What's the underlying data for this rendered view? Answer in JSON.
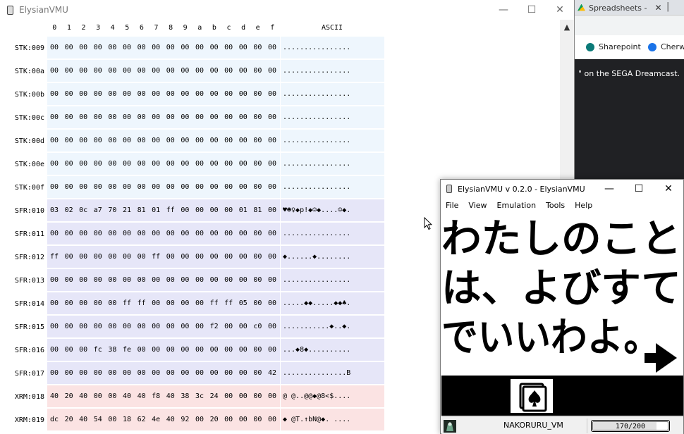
{
  "background_browser": {
    "tab_title": "Spreadsheets -",
    "tab_close": "✕",
    "bookmarks": [
      {
        "label": "Sharepoint",
        "color": "#0b7a78"
      },
      {
        "label": "Cherw",
        "color": "#1a73e8"
      }
    ],
    "headline": "\" on the SEGA Dreamcast."
  },
  "memory_window": {
    "title": "ElysianVMU",
    "minimize": "—",
    "maximize": "☐",
    "close": "✕",
    "scroll_up": "▲",
    "columns": [
      "0",
      "1",
      "2",
      "3",
      "4",
      "5",
      "6",
      "7",
      "8",
      "9",
      "a",
      "b",
      "c",
      "d",
      "e",
      "f"
    ],
    "ascii_header": "ASCII",
    "rows": [
      {
        "region": "stk",
        "label": "STK:009",
        "bytes": [
          "00",
          "00",
          "00",
          "00",
          "00",
          "00",
          "00",
          "00",
          "00",
          "00",
          "00",
          "00",
          "00",
          "00",
          "00",
          "00"
        ],
        "ascii": "................"
      },
      {
        "region": "stk",
        "label": "STK:00a",
        "bytes": [
          "00",
          "00",
          "00",
          "00",
          "00",
          "00",
          "00",
          "00",
          "00",
          "00",
          "00",
          "00",
          "00",
          "00",
          "00",
          "00"
        ],
        "ascii": "................"
      },
      {
        "region": "stk",
        "label": "STK:00b",
        "bytes": [
          "00",
          "00",
          "00",
          "00",
          "00",
          "00",
          "00",
          "00",
          "00",
          "00",
          "00",
          "00",
          "00",
          "00",
          "00",
          "00"
        ],
        "ascii": "................"
      },
      {
        "region": "stk",
        "label": "STK:00c",
        "bytes": [
          "00",
          "00",
          "00",
          "00",
          "00",
          "00",
          "00",
          "00",
          "00",
          "00",
          "00",
          "00",
          "00",
          "00",
          "00",
          "00"
        ],
        "ascii": "................"
      },
      {
        "region": "stk",
        "label": "STK:00d",
        "bytes": [
          "00",
          "00",
          "00",
          "00",
          "00",
          "00",
          "00",
          "00",
          "00",
          "00",
          "00",
          "00",
          "00",
          "00",
          "00",
          "00"
        ],
        "ascii": "................"
      },
      {
        "region": "stk",
        "label": "STK:00e",
        "bytes": [
          "00",
          "00",
          "00",
          "00",
          "00",
          "00",
          "00",
          "00",
          "00",
          "00",
          "00",
          "00",
          "00",
          "00",
          "00",
          "00"
        ],
        "ascii": "................"
      },
      {
        "region": "stk",
        "label": "STK:00f",
        "bytes": [
          "00",
          "00",
          "00",
          "00",
          "00",
          "00",
          "00",
          "00",
          "00",
          "00",
          "00",
          "00",
          "00",
          "00",
          "00",
          "00"
        ],
        "ascii": "................"
      },
      {
        "region": "sfr",
        "label": "SFR:010",
        "bytes": [
          "03",
          "02",
          "0c",
          "a7",
          "70",
          "21",
          "81",
          "01",
          "ff",
          "00",
          "00",
          "00",
          "00",
          "01",
          "81",
          "00"
        ],
        "ascii": "♥☻♀◆p!◆☺◆....☺◆."
      },
      {
        "region": "sfr",
        "label": "SFR:011",
        "bytes": [
          "00",
          "00",
          "00",
          "00",
          "00",
          "00",
          "00",
          "00",
          "00",
          "00",
          "00",
          "00",
          "00",
          "00",
          "00",
          "00"
        ],
        "ascii": "................"
      },
      {
        "region": "sfr",
        "label": "SFR:012",
        "bytes": [
          "ff",
          "00",
          "00",
          "00",
          "00",
          "00",
          "00",
          "ff",
          "00",
          "00",
          "00",
          "00",
          "00",
          "00",
          "00",
          "00"
        ],
        "ascii": "◆......◆........"
      },
      {
        "region": "sfr",
        "label": "SFR:013",
        "bytes": [
          "00",
          "00",
          "00",
          "00",
          "00",
          "00",
          "00",
          "00",
          "00",
          "00",
          "00",
          "00",
          "00",
          "00",
          "00",
          "00"
        ],
        "ascii": "................"
      },
      {
        "region": "sfr",
        "label": "SFR:014",
        "bytes": [
          "00",
          "00",
          "00",
          "00",
          "00",
          "ff",
          "ff",
          "00",
          "00",
          "00",
          "00",
          "ff",
          "ff",
          "05",
          "00",
          "00"
        ],
        "ascii": ".....◆◆.....◆◆♣."
      },
      {
        "region": "sfr",
        "label": "SFR:015",
        "bytes": [
          "00",
          "00",
          "00",
          "00",
          "00",
          "00",
          "00",
          "00",
          "00",
          "00",
          "00",
          "f2",
          "00",
          "00",
          "c0",
          "00"
        ],
        "ascii": "...........◆..◆."
      },
      {
        "region": "sfr",
        "label": "SFR:016",
        "bytes": [
          "00",
          "00",
          "00",
          "fc",
          "38",
          "fe",
          "00",
          "00",
          "00",
          "00",
          "00",
          "00",
          "00",
          "00",
          "00",
          "00"
        ],
        "ascii": "...◆8◆.........."
      },
      {
        "region": "sfr",
        "label": "SFR:017",
        "bytes": [
          "00",
          "00",
          "00",
          "00",
          "00",
          "00",
          "00",
          "00",
          "00",
          "00",
          "00",
          "00",
          "00",
          "00",
          "00",
          "42"
        ],
        "ascii": "...............B"
      },
      {
        "region": "xrm",
        "label": "XRM:018",
        "bytes": [
          "40",
          "20",
          "40",
          "00",
          "00",
          "40",
          "40",
          "f8",
          "40",
          "38",
          "3c",
          "24",
          "00",
          "00",
          "00",
          "00"
        ],
        "ascii": "@ @..@@◆@8<$...."
      },
      {
        "region": "xrm",
        "label": "XRM:019",
        "bytes": [
          "dc",
          "20",
          "40",
          "54",
          "00",
          "18",
          "62",
          "4e",
          "40",
          "92",
          "00",
          "20",
          "00",
          "00",
          "00",
          "00"
        ],
        "ascii": "◆ @T.↑bN@◆. ...."
      }
    ]
  },
  "emulator_window": {
    "title": "ElysianVMU v 0.2.0 - ElysianVMU",
    "minimize": "—",
    "maximize": "☐",
    "close": "✕",
    "menu": [
      "File",
      "View",
      "Emulation",
      "Tools",
      "Help"
    ],
    "lcd_text": [
      "わたしのこと",
      "は、よびすて",
      "でいいわよ。"
    ],
    "lcd_arrow": "➡",
    "card_icon": "spade-card-icon",
    "status": {
      "name": "NAKORURU_VM",
      "battery_text": "170/200",
      "battery_value": 170,
      "battery_max": 200
    }
  }
}
